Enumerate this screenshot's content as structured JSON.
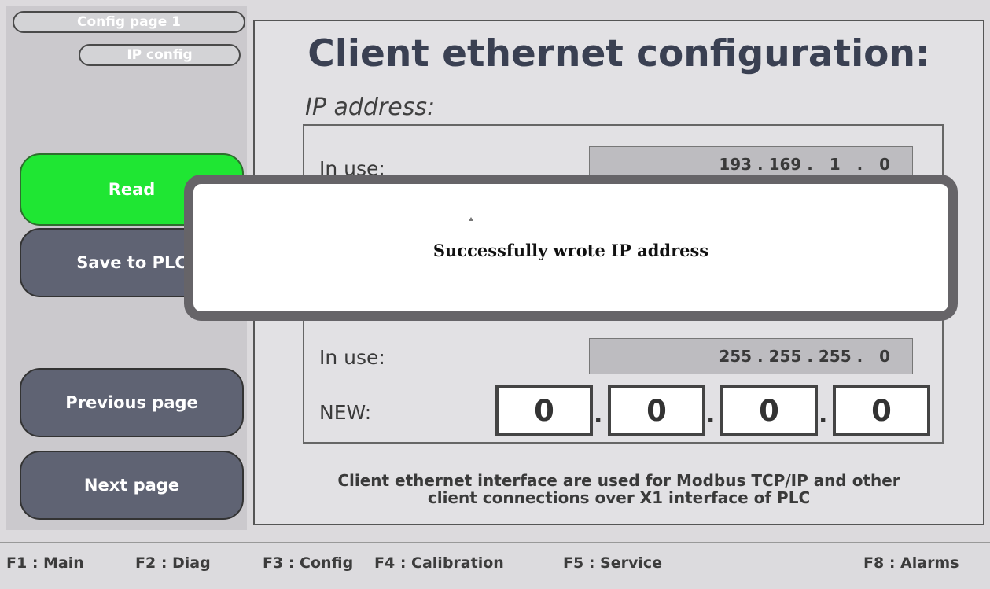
{
  "sidebar": {
    "config_page": "Config page 1",
    "ip_config": "IP config",
    "read": "Read",
    "save": "Save to PLC",
    "previous": "Previous page",
    "next": "Next page"
  },
  "main": {
    "title": "Client ethernet configuration:",
    "ip_label": "IP address:",
    "in_use_label": "In use:",
    "ip_in_use": "193 . 169 .   1   .   0",
    "subnet_in_use_label": "In use:",
    "subnet_in_use": "255 . 255 . 255 .   0",
    "new_label": "NEW:",
    "new_octets": [
      "0",
      "0",
      "0",
      "0"
    ],
    "dot": ".",
    "note_line1": "Client ethernet interface are used for Modbus TCP/IP and other",
    "note_line2": "client connections over X1 interface of PLC"
  },
  "popup": {
    "message": "Successfully wrote IP address"
  },
  "footer": {
    "f1": "F1 : Main",
    "f2": "F2 : Diag",
    "f3": "F3 : Config",
    "f4": "F4 : Calibration",
    "f5": "F5 : Service",
    "f8": "F8 : Alarms"
  },
  "colors": {
    "read_button": "#1fe633",
    "nav_button": "#5f6373",
    "title_text": "#3a4052"
  }
}
